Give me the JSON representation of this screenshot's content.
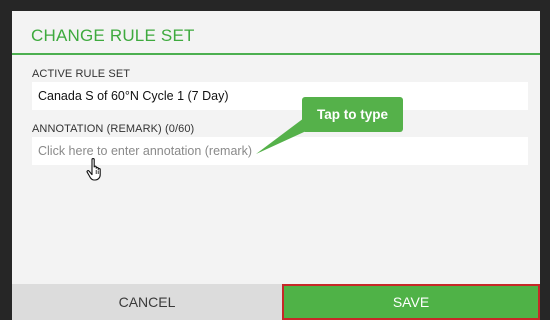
{
  "dialog": {
    "title": "CHANGE RULE SET",
    "active_rule_set": {
      "label": "ACTIVE RULE SET",
      "value": "Canada S of 60°N Cycle 1 (7 Day)"
    },
    "annotation": {
      "label": "ANNOTATION (REMARK) (0/60)",
      "placeholder": "Click here to enter annotation (remark)",
      "value": ""
    },
    "tooltip": "Tap to type",
    "buttons": {
      "cancel": "CANCEL",
      "save": "SAVE"
    }
  },
  "icons": {
    "pointer": "hand-pointer-icon"
  },
  "colors": {
    "accent": "#4caf50",
    "title": "#3eaa3e",
    "save_button": "#4fb247",
    "save_outline": "#c62828",
    "cancel_button": "#dcdcdc",
    "tooltip": "#55b14a",
    "frame": "#262626"
  }
}
